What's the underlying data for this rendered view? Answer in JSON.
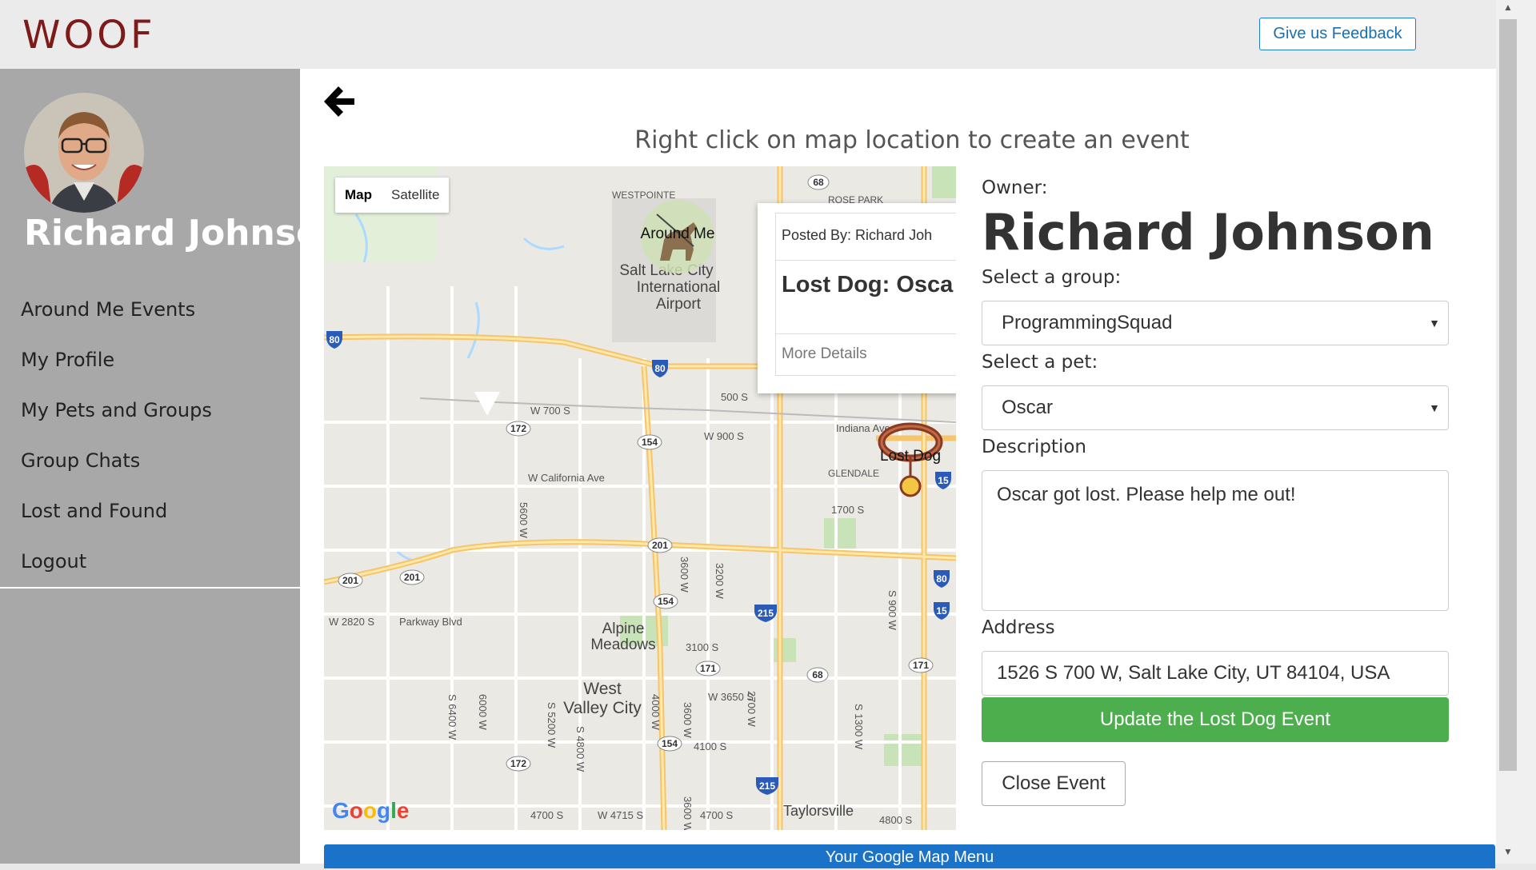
{
  "header": {
    "logo": "WOOF",
    "feedback_label": "Give us Feedback"
  },
  "sidebar": {
    "user_name": "Richard Johnson",
    "items": [
      {
        "label": "Around Me Events"
      },
      {
        "label": "My Profile"
      },
      {
        "label": "My Pets and Groups"
      },
      {
        "label": "Group Chats"
      },
      {
        "label": "Lost and Found"
      },
      {
        "label": "Logout"
      }
    ]
  },
  "main": {
    "instructions": "Right click on map location to create an event",
    "bottom_menu": "Your Google Map Menu"
  },
  "map": {
    "type_map": "Map",
    "type_satellite": "Satellite",
    "google": "Google",
    "labels": {
      "around_me": "Around Me",
      "lost_dog": "Lost Dog",
      "westpointe": "WESTPOINTE",
      "rose_park": "ROSE PARK",
      "airport1": "Salt Lake City",
      "airport2": "International",
      "airport3": "Airport",
      "w700s": "W 700 S",
      "w900s": "W 900 S",
      "s500": "500 S",
      "indiana": "Indiana Ave",
      "glendale": "GLENDALE",
      "calif": "W California Ave",
      "s1700": "1700 S",
      "w5600": "5600 W",
      "w2820": "W 2820 S",
      "parkway": "Parkway Blvd",
      "alpine1": "Alpine",
      "alpine2": "Meadows",
      "s3100": "3100 S",
      "westvalley1": "West",
      "westvalley2": "Valley City",
      "w3650": "W 3650 S",
      "s4100": "4100 S",
      "taylorsville": "Taylorsville",
      "s4700a": "4700 S",
      "w4715": "W 4715 S",
      "s4700b": "4700 S",
      "s4800": "4800 S",
      "w3600": "3600 W",
      "w3200": "3200 W",
      "s900w": "S 900 W",
      "s1300w": "S 1300 W",
      "s6400": "S 6400 W",
      "w6000": "6000 W",
      "s5200": "S 5200 W",
      "s4800w": "S 4800 W",
      "w4000": "4000 W",
      "w3600b": "3600 W",
      "w2700": "2700 W",
      "w3600c": "3600 W",
      "shield_68a": "68",
      "shield_80a": "80",
      "shield_80b": "80",
      "shield_172a": "172",
      "shield_154a": "154",
      "shield_15a": "15",
      "shield_201a": "201",
      "shield_201b": "201",
      "shield_201c": "201",
      "shield_80c": "80",
      "shield_15b": "15",
      "shield_154b": "154",
      "shield_215a": "215",
      "shield_171a": "171",
      "shield_68b": "68",
      "shield_171b": "171",
      "shield_154c": "154",
      "shield_172b": "172",
      "shield_215b": "215"
    },
    "infowindow": {
      "posted_by": "Posted By: Richard Joh",
      "title": "Lost Dog: Osca",
      "more_details": "More Details"
    }
  },
  "form": {
    "owner_label": "Owner:",
    "owner_name": "Richard Johnson",
    "group_label": "Select a group:",
    "group_value": "ProgrammingSquad",
    "pet_label": "Select a pet:",
    "pet_value": "Oscar",
    "description_label": "Description",
    "description_value": "Oscar got lost. Please help me out!",
    "address_label": "Address",
    "address_value": "1526 S 700 W, Salt Lake City, UT 84104, USA",
    "update_label": "Update the Lost Dog Event",
    "close_label": "Close Event"
  }
}
